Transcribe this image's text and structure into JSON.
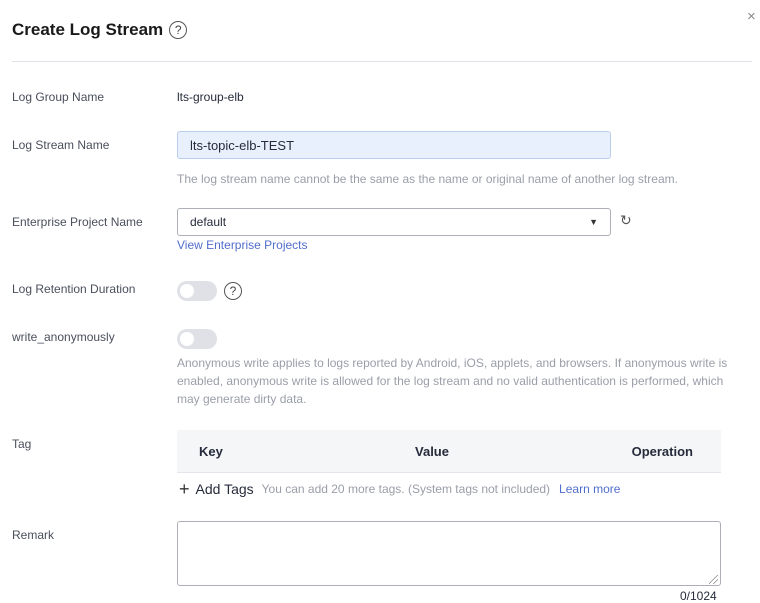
{
  "header": {
    "title": "Create Log Stream",
    "help_icon": "question-circle-icon",
    "close_icon": "close-icon",
    "close_glyph": "×"
  },
  "fields": {
    "log_group": {
      "label": "Log Group Name",
      "value": "lts-group-elb"
    },
    "log_stream": {
      "label": "Log Stream Name",
      "value": "lts-topic-elb-TEST",
      "hint": "The log stream name cannot be the same as the name or original name of another log stream."
    },
    "enterprise_project": {
      "label": "Enterprise Project Name",
      "selected": "default",
      "link": "View Enterprise Projects"
    },
    "retention": {
      "label": "Log Retention Duration",
      "enabled": false
    },
    "anonymous": {
      "label": "write_anonymously",
      "enabled": false,
      "hint": "Anonymous write applies to logs reported by Android, iOS, applets, and browsers. If anonymous write is enabled, anonymous write is allowed for the log stream and no valid authentication is performed, which may generate dirty data."
    },
    "tag": {
      "label": "Tag",
      "columns": [
        "Key",
        "Value",
        "Operation"
      ],
      "add_label": "Add Tags",
      "add_hint": "You can add 20 more tags. (System tags not included)",
      "learn_more": "Learn more"
    },
    "remark": {
      "label": "Remark",
      "value": "",
      "counter": "0/1024"
    }
  },
  "colors": {
    "accent_link": "#526ecc",
    "input_fill": "#e8f0fe",
    "toggle_off": "#dfe1e6"
  }
}
